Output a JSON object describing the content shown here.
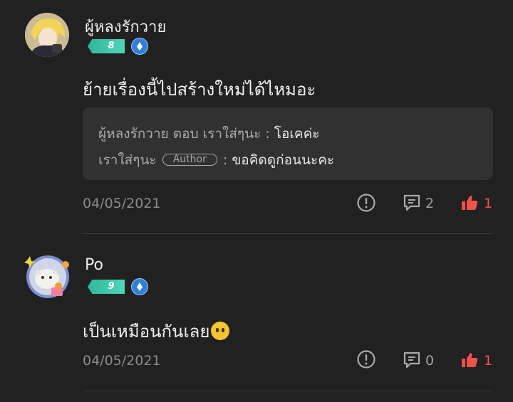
{
  "comments": [
    {
      "username": "ผู้หลงรักวาย",
      "level": "8",
      "text": "ย้ายเรื่องนี้ไปสร้างใหม่ได้ไหมอะ",
      "replies": [
        {
          "author": "ผู้หลงรักวาย",
          "connector": " ตอบ ",
          "target": "เราใส่ๆนะ",
          "separator": " : ",
          "text": "โอเคค่ะ"
        },
        {
          "author": "เราใส่ๆนะ",
          "tag": "Author",
          "separator": " : ",
          "text": "ขอคิดดูก่อนนะคะ"
        }
      ],
      "date": "04/05/2021",
      "reply_count": "2",
      "like_count": "1"
    },
    {
      "username": "Po",
      "level": "9",
      "text": "เป็นเหมือนกันเลย",
      "emoji": "neutral-face-emoji",
      "date": "04/05/2021",
      "reply_count": "0",
      "like_count": "1"
    }
  ],
  "colors": {
    "background": "#212121",
    "reply_box": "#313131",
    "level_badge": "#3cc6a8",
    "verify_badge": "#2f7fd6",
    "like": "#f0514d",
    "muted": "#8a8a8a"
  },
  "icons": {
    "report": "exclamation-circle-icon",
    "reply": "chat-bubble-icon",
    "like": "thumbs-up-icon",
    "verified": "verified-diamond-icon"
  }
}
